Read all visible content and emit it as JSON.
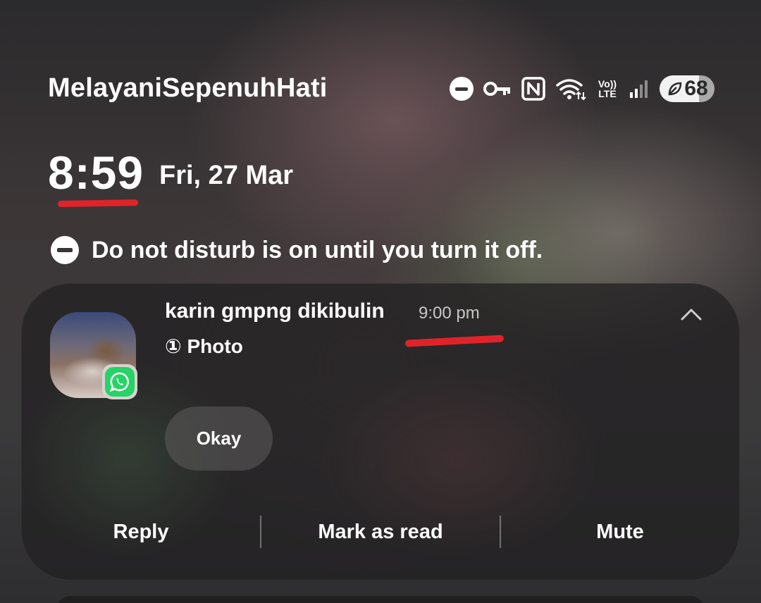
{
  "status_bar": {
    "carrier": "MelayaniSepenuhHati",
    "network_label_top": "Vo))",
    "network_label_bottom": "LTE",
    "battery_level": "68",
    "icons": [
      "do-not-disturb-icon",
      "vpn-key-icon",
      "nfc-icon",
      "wifi-icon",
      "volte-icon",
      "signal-icon",
      "battery-saver-icon"
    ]
  },
  "clock": {
    "time": "8:59",
    "date": "Fri, 27 Mar"
  },
  "dnd_banner": {
    "text": "Do not disturb is on until you turn it off."
  },
  "notification": {
    "app_icon": "whatsapp-icon",
    "sender": "karin gmpng dikibulin",
    "time": "9:00 pm",
    "message": "① Photo",
    "quick_reply": "Okay",
    "actions": {
      "reply": "Reply",
      "mark_as_read": "Mark as read",
      "mute": "Mute"
    }
  },
  "colors": {
    "annotation_red": "#e0232a",
    "whatsapp_green": "#25d366",
    "card_bg": "#222122"
  }
}
